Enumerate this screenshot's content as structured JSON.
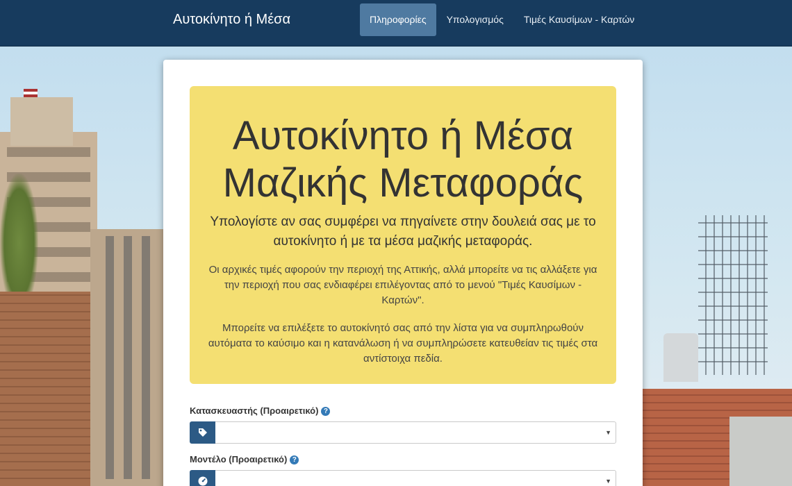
{
  "navbar": {
    "brand": "Αυτοκίνητο ή Μέσα",
    "links": [
      {
        "label": "Πληροφορίες",
        "active": true
      },
      {
        "label": "Υπολογισμός",
        "active": false
      },
      {
        "label": "Τιμές Καυσίμων - Καρτών",
        "active": false
      }
    ]
  },
  "jumbotron": {
    "title_line1": "Αυτοκίνητο ή Μέσα",
    "title_line2": "Μαζικής Μεταφοράς",
    "lead": "Υπολογίστε αν σας συμφέρει να πηγαίνετε στην δουλειά σας με το αυτοκίνητο ή με τα μέσα μαζικής μεταφοράς.",
    "info1": "Οι αρχικές τιμές αφορούν την περιοχή της Αττικής, αλλά μπορείτε να τις αλλάξετε για την περιοχή που σας ενδιαφέρει επιλέγοντας από το μενού \"Τιμές Καυσίμων - Καρτών\".",
    "info2": "Μπορείτε να επιλέξετε το αυτοκίνητό σας από την λίστα για να συμπληρωθούν αυτόματα το καύσιμο και η κατανάλωση ή να συμπληρώσετε κατευθείαν τις τιμές στα αντίστοιχα πεδία."
  },
  "form": {
    "manufacturer_label": "Κατασκευαστής (Προαιρετικό)",
    "manufacturer_value": "",
    "model_label": "Μοντέλο (Προαιρετικό)",
    "model_value": "",
    "help_glyph": "?",
    "caret_glyph": "▼"
  },
  "colors": {
    "navbar": "#173b5e",
    "active_tab": "#4f7aa1",
    "jumbotron": "#f4df72",
    "addon": "#2c5a85"
  },
  "icons": {
    "manufacturer_addon": "tag-icon",
    "model_addon": "dashboard-icon",
    "help": "question-circle-icon"
  }
}
